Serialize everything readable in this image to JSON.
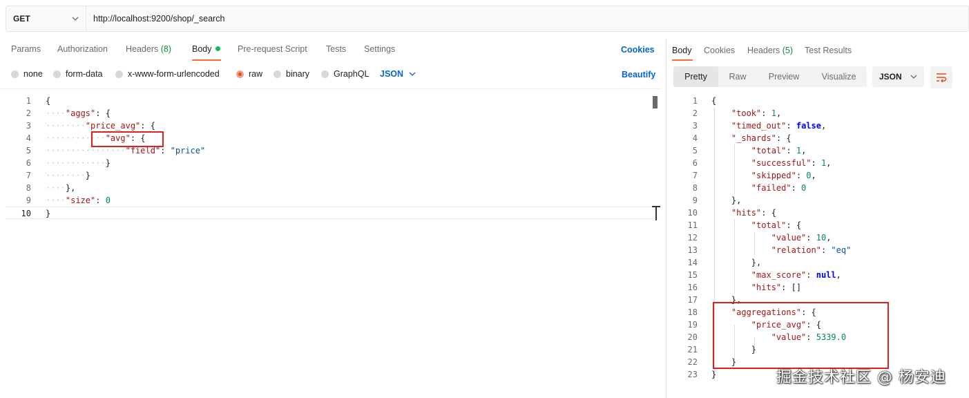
{
  "request": {
    "method": "GET",
    "url": "http://localhost:9200/shop/_search"
  },
  "request_tabs": {
    "params": "Params",
    "authorization": "Authorization",
    "headers": "Headers",
    "headers_count": "(8)",
    "body": "Body",
    "pre_request": "Pre-request Script",
    "tests": "Tests",
    "settings": "Settings",
    "cookies": "Cookies"
  },
  "body_types": {
    "none": "none",
    "form_data": "form-data",
    "urlencoded": "x-www-form-urlencoded",
    "raw": "raw",
    "binary": "binary",
    "graphql": "GraphQL",
    "format": "JSON",
    "beautify": "Beautify"
  },
  "request_body_lines": [
    {
      "n": "1"
    },
    {
      "n": "2"
    },
    {
      "n": "3"
    },
    {
      "n": "4"
    },
    {
      "n": "5"
    },
    {
      "n": "6"
    },
    {
      "n": "7"
    },
    {
      "n": "8"
    },
    {
      "n": "9"
    },
    {
      "n": "10"
    }
  ],
  "request_body": {
    "aggs_key": "\"aggs\"",
    "price_avg_key": "\"price_avg\"",
    "avg_key": "\"avg\"",
    "field_key": "\"field\"",
    "field_value": "\"price\"",
    "size_key": "\"size\"",
    "size_value": "0"
  },
  "response_tabs": {
    "body": "Body",
    "cookies": "Cookies",
    "headers": "Headers",
    "headers_count": "(5)",
    "test_results": "Test Results"
  },
  "response_view": {
    "pretty": "Pretty",
    "raw": "Raw",
    "preview": "Preview",
    "visualize": "Visualize",
    "format": "JSON"
  },
  "response_body": {
    "took_key": "\"took\"",
    "took_value": "1",
    "timed_out_key": "\"timed_out\"",
    "timed_out_value": "false",
    "shards_key": "\"_shards\"",
    "total_key": "\"total\"",
    "total_value": "1",
    "successful_key": "\"successful\"",
    "successful_value": "1",
    "skipped_key": "\"skipped\"",
    "skipped_value": "0",
    "failed_key": "\"failed\"",
    "failed_value": "0",
    "hits_key": "\"hits\"",
    "hits_total_key": "\"total\"",
    "value_key": "\"value\"",
    "value_value": "10",
    "relation_key": "\"relation\"",
    "relation_value": "\"eq\"",
    "max_score_key": "\"max_score\"",
    "max_score_value": "null",
    "hits_inner_key": "\"hits\"",
    "hits_inner_value": "[]",
    "aggregations_key": "\"aggregations\"",
    "price_avg_key": "\"price_avg\"",
    "agg_value_key": "\"value\"",
    "agg_value_value": "5339.0"
  },
  "watermark": "掘金技术社区 @ 杨安迪",
  "colors": {
    "accent": "#ff6c37",
    "link": "#0265d2",
    "highlight_box": "#e02020"
  }
}
